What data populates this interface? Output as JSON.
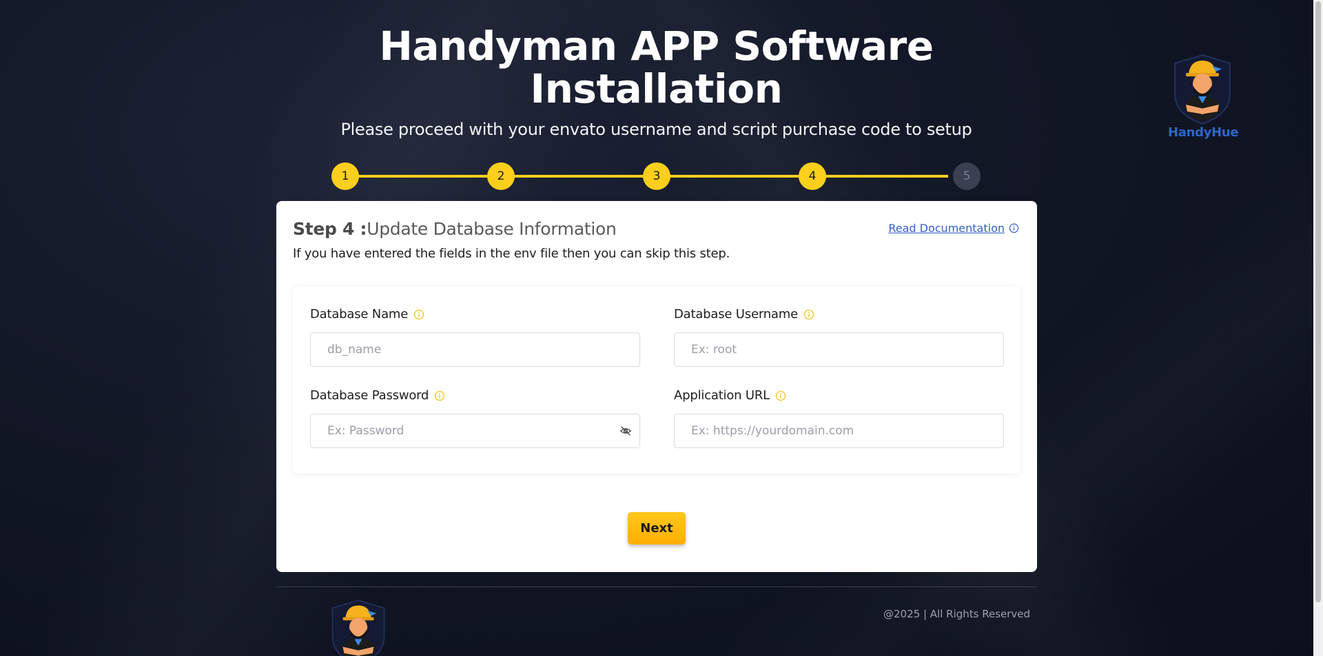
{
  "header": {
    "title": "Handyman APP Software Installation",
    "subtitle": "Please proceed with your envato username and script purchase code to setup"
  },
  "brand": {
    "name": "HandyHue",
    "logo_icon": "handyman-logo-icon"
  },
  "stepper": {
    "steps": [
      "1",
      "2",
      "3",
      "4",
      "5"
    ],
    "current": 4
  },
  "card": {
    "step_prefix": "Step 4 :",
    "step_title": "Update Database Information",
    "description": "If you have entered the fields in the env file then you can skip this step.",
    "doc_link": "Read Documentation"
  },
  "form": {
    "db_name": {
      "label": "Database Name",
      "placeholder": "db_name",
      "value": ""
    },
    "db_username": {
      "label": "Database Username",
      "placeholder": "Ex: root",
      "value": ""
    },
    "db_password": {
      "label": "Database Password",
      "placeholder": "Ex: Password",
      "value": ""
    },
    "app_url": {
      "label": "Application URL",
      "placeholder": "Ex: https://yourdomain.com",
      "value": ""
    }
  },
  "actions": {
    "next_label": "Next"
  },
  "footer": {
    "copyright": "@2025 | All Rights Reserved"
  },
  "colors": {
    "accent": "#fccf1c",
    "button": "#ffb800",
    "link": "#3560c8",
    "brand": "#2f67c9",
    "background": "#121726"
  }
}
